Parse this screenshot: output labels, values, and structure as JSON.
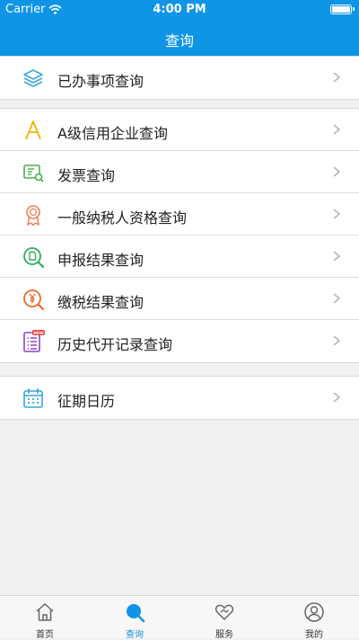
{
  "status_bar": {
    "carrier": "Carrier",
    "time": "4:00 PM"
  },
  "header": {
    "title": "查询"
  },
  "menu": {
    "item_0": {
      "label": "已办事项查询",
      "icon": "layers-icon"
    },
    "item_1": {
      "label": "A级信用企业查询",
      "icon": "letter-a-icon"
    },
    "item_2": {
      "label": "发票查询",
      "icon": "invoice-search-icon"
    },
    "item_3": {
      "label": "一般纳税人资格查询",
      "icon": "ribbon-badge-icon"
    },
    "item_4": {
      "label": "申报结果查询",
      "icon": "document-search-icon"
    },
    "item_5": {
      "label": "缴税结果查询",
      "icon": "yuan-search-icon"
    },
    "item_6": {
      "label": "历史代开记录查询",
      "icon": "list-new-icon",
      "badge": "NEW"
    },
    "item_7": {
      "label": "征期日历",
      "icon": "calendar-icon"
    }
  },
  "tabbar": {
    "home": "首页",
    "query": "查询",
    "service": "服务",
    "mine": "我的"
  },
  "colors": {
    "accent": "#0f94e6"
  }
}
